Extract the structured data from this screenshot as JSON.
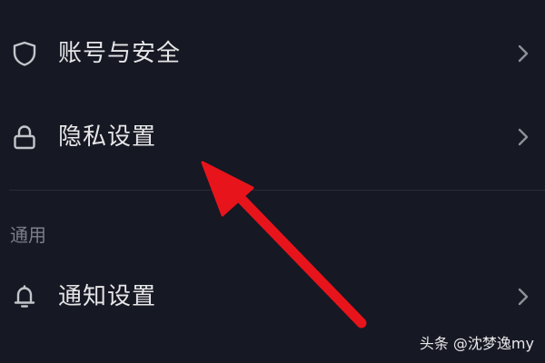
{
  "settings": {
    "rows": [
      {
        "label": "账号与安全",
        "icon": "shield-icon",
        "chevron": "chevron-right-icon"
      },
      {
        "label": "隐私设置",
        "icon": "lock-icon",
        "chevron": "chevron-right-icon"
      }
    ],
    "general_section": {
      "header": "通用",
      "rows": [
        {
          "label": "通知设置",
          "icon": "bell-icon",
          "chevron": "chevron-right-icon"
        }
      ]
    }
  },
  "annotation": {
    "type": "arrow",
    "color": "#e8141b",
    "points_to": "隐私设置"
  },
  "watermark": {
    "text": "头条 @沈梦逸my"
  },
  "colors": {
    "background": "#161823",
    "text": "#e6e6e8",
    "icon": "#c4c5ca",
    "section_header": "#7d7f88",
    "divider": "#2a2c36"
  }
}
